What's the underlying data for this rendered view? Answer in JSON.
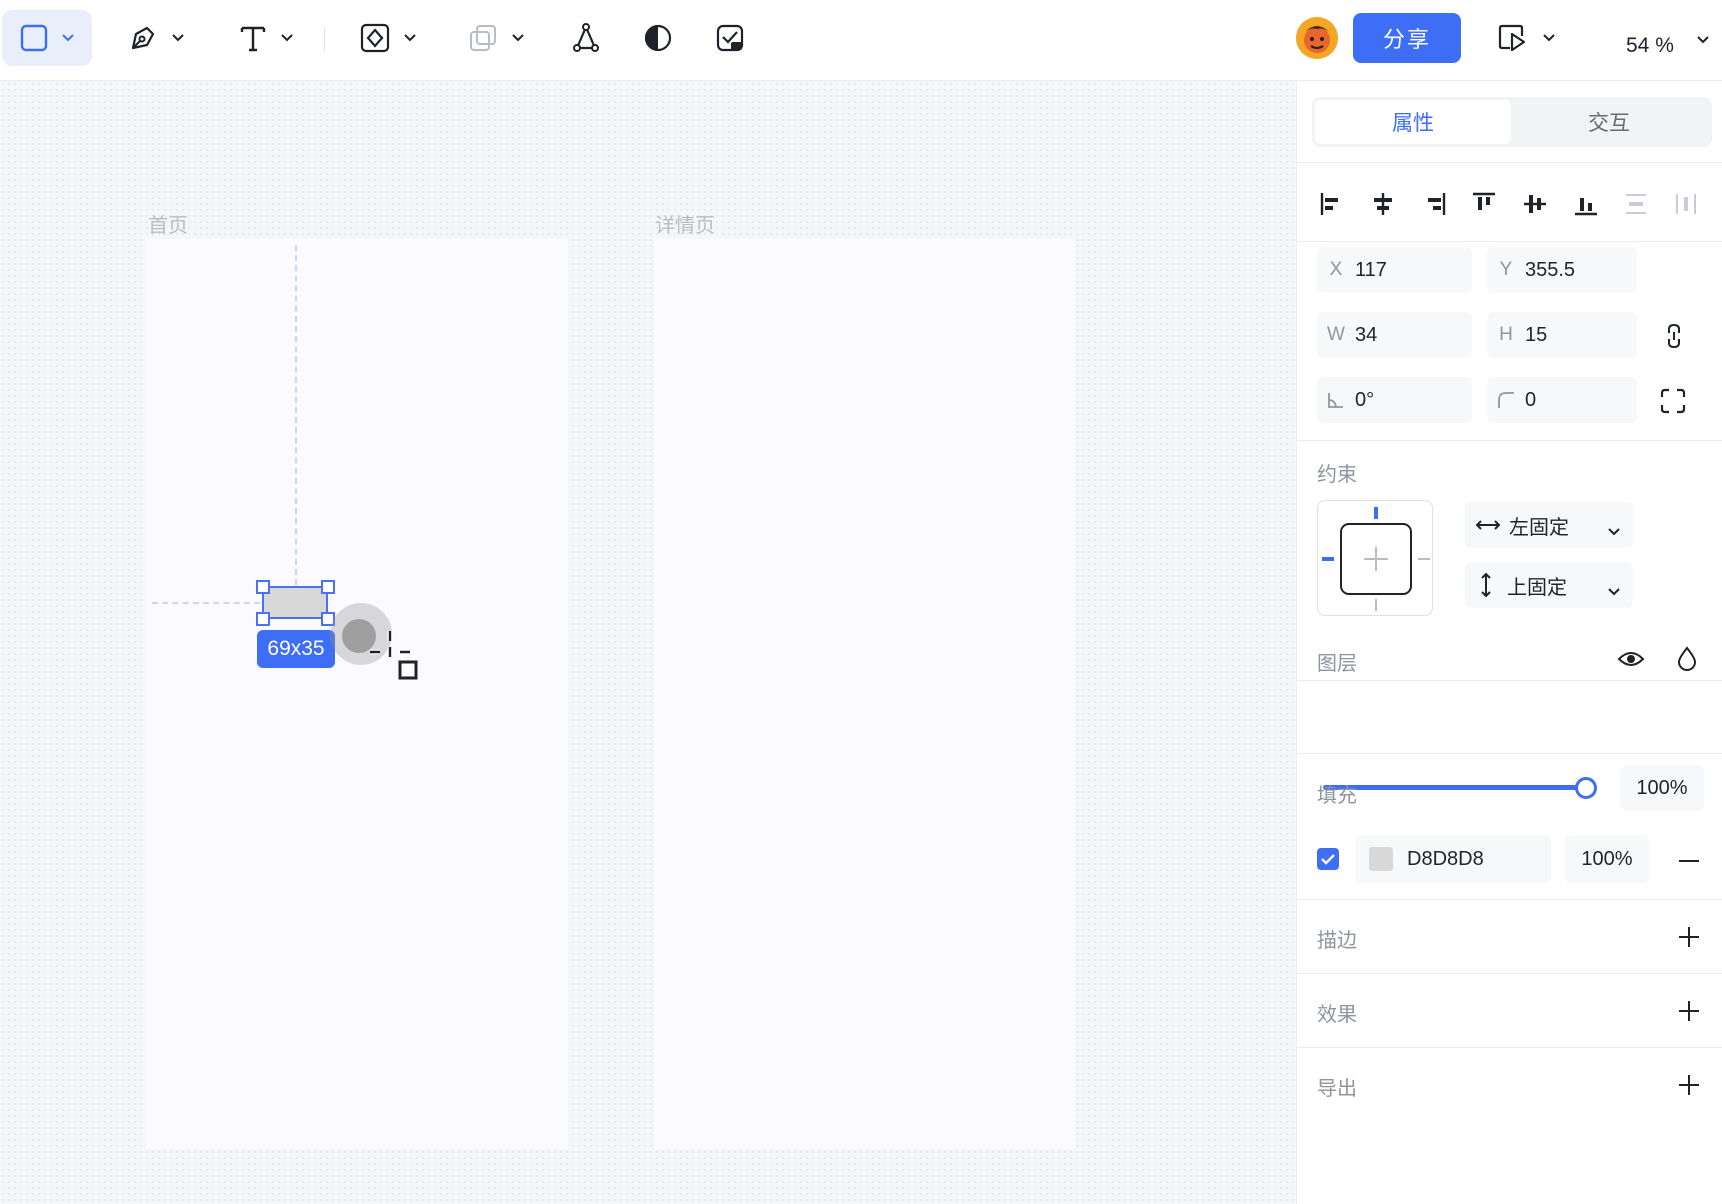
{
  "toolbar": {
    "tools": [
      {
        "name": "rectangle-tool",
        "active": true
      },
      {
        "name": "pen-tool"
      },
      {
        "name": "text-tool"
      },
      {
        "name": "component-tool"
      },
      {
        "name": "boolean-tool"
      },
      {
        "name": "vector-network-tool"
      },
      {
        "name": "mask-tool"
      },
      {
        "name": "ai-tool"
      }
    ],
    "share_label": "分享",
    "zoom": "54 %"
  },
  "canvas": {
    "frames": [
      {
        "label": "首页"
      },
      {
        "label": "详情页"
      }
    ],
    "selection_size": "69x35",
    "shape_fill": "#D8D8D8",
    "accent": "#3D6EF5"
  },
  "panel": {
    "tabs": [
      "属性",
      "交互"
    ],
    "active_tab": "属性",
    "geometry": {
      "x_label": "X",
      "x": "117",
      "y_label": "Y",
      "y": "355.5",
      "w_label": "W",
      "w": "34",
      "h_label": "H",
      "h": "15",
      "rotation": "0°",
      "radius": "0"
    },
    "constraints": {
      "title": "约束",
      "horizontal": "左固定",
      "vertical": "上固定"
    },
    "layer": {
      "title": "图层",
      "opacity": "100%",
      "opacity_value": 1.0
    },
    "fill": {
      "title": "填充",
      "enabled": true,
      "color": "D8D8D8",
      "opacity": "100%"
    },
    "stroke": {
      "title": "描边"
    },
    "effects": {
      "title": "效果"
    },
    "export": {
      "title": "导出"
    }
  }
}
